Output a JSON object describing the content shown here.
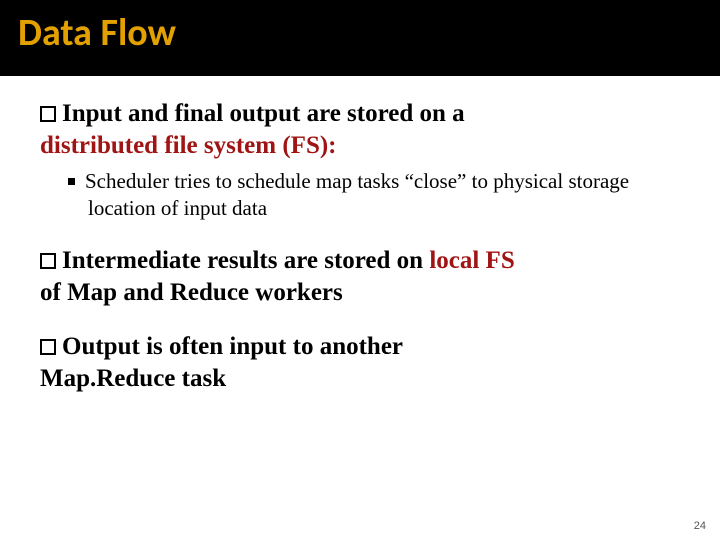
{
  "title": "Data Flow",
  "bullets": {
    "b1": {
      "prefix": "Input and final output",
      "middle": " are stored on a ",
      "accent": "distributed file system (FS):",
      "sub": "Scheduler tries to schedule map tasks “close” to physical storage location of input data"
    },
    "b2": {
      "prefix": "Intermediate results",
      "middle": " are stored on ",
      "accent": "local FS",
      "rest": "of Map and Reduce workers"
    },
    "b3": {
      "prefix": "Output",
      "middle": " is often input to another ",
      "rest": "Map.Reduce task"
    }
  },
  "pagenum": "24"
}
